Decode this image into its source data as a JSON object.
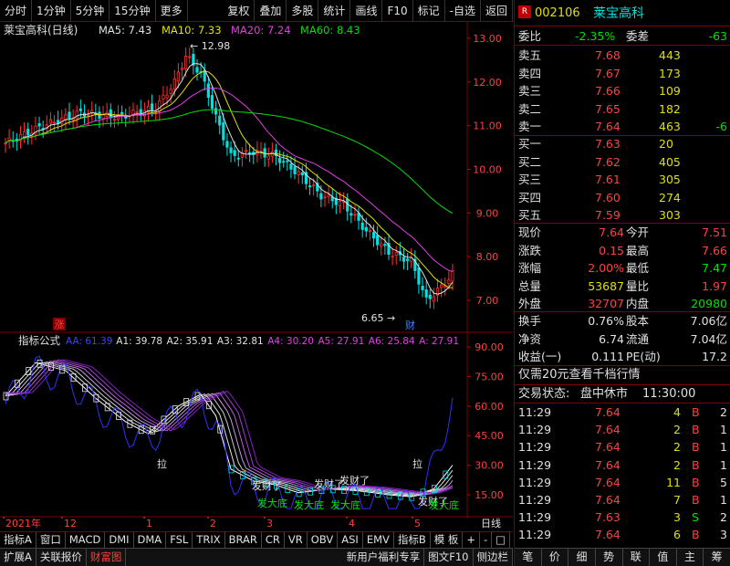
{
  "toolbar": {
    "left": [
      "分时",
      "1分钟",
      "5分钟",
      "15分钟",
      "更多"
    ],
    "right": [
      "复权",
      "叠加",
      "多股",
      "统计",
      "画线",
      "F10",
      "标记",
      "-自选",
      "返回"
    ]
  },
  "main_chart": {
    "title": "莱宝高科(日线)",
    "ma": [
      {
        "label": "MA5: 7.43",
        "color": "#e0e0e0"
      },
      {
        "label": "MA10: 7.33",
        "color": "#e0e000"
      },
      {
        "label": "MA20: 7.24",
        "color": "#e040e0"
      },
      {
        "label": "MA60: 8.43",
        "color": "#00e000"
      }
    ],
    "price_axis": [
      "13.00",
      "12.00",
      "11.00",
      "10.00",
      "9.00",
      "8.00",
      "7.00"
    ],
    "high_marker": "12.98",
    "low_marker": "6.65",
    "limit_up_badge": "涨",
    "cai_badge": "财"
  },
  "indicator_chart": {
    "title": "指标公式",
    "params": [
      {
        "label": "AA: 61.39",
        "color": "#4040ff"
      },
      {
        "label": "A1: 39.78",
        "color": "#e0e0e0"
      },
      {
        "label": "A2: 35.91",
        "color": "#e0e0e0"
      },
      {
        "label": "A3: 32.81",
        "color": "#e0e0e0"
      },
      {
        "label": "A4: 30.20",
        "color": "#e040e0"
      },
      {
        "label": "A5: 27.91",
        "color": "#e040e0"
      },
      {
        "label": "A6: 25.84",
        "color": "#e040e0"
      },
      {
        "label": "A: 27.91",
        "color": "#e040e0"
      }
    ],
    "axis": [
      "90.00",
      "75.00",
      "60.00",
      "45.00",
      "30.00",
      "15.00"
    ],
    "annotations": [
      "拉",
      "拉",
      "发财了",
      "发财了",
      "发财了",
      "发财了",
      "发大底",
      "发大底",
      "发大底",
      "发大底"
    ]
  },
  "date_axis": [
    "2021年",
    "12",
    "1",
    "2",
    "3",
    "4",
    "5",
    "日线"
  ],
  "ind_tabs": [
    "指标A",
    "窗口",
    "MACD",
    "DMI",
    "DMA",
    "FSL",
    "TRIX",
    "BRAR",
    "CR",
    "VR",
    "OBV",
    "ASI",
    "EMV",
    "指标B",
    "模 板",
    "+",
    "-",
    "□"
  ],
  "bottom_tabs": [
    "扩展A",
    "关联报价",
    "财富图",
    "新用户福利专享",
    "图文F10",
    "侧边栏"
  ],
  "quote": {
    "code": "002106",
    "name": "莱宝高科",
    "weibi_label": "委比",
    "weibi": "-2.35%",
    "weicha_label": "委差",
    "weicha": "-63",
    "asks": [
      {
        "label": "卖五",
        "price": "7.68",
        "vol": "443",
        "diff": ""
      },
      {
        "label": "卖四",
        "price": "7.67",
        "vol": "173",
        "diff": ""
      },
      {
        "label": "卖三",
        "price": "7.66",
        "vol": "109",
        "diff": ""
      },
      {
        "label": "卖二",
        "price": "7.65",
        "vol": "182",
        "diff": ""
      },
      {
        "label": "卖一",
        "price": "7.64",
        "vol": "463",
        "diff": "-6"
      }
    ],
    "bids": [
      {
        "label": "买一",
        "price": "7.63",
        "vol": "20"
      },
      {
        "label": "买二",
        "price": "7.62",
        "vol": "405"
      },
      {
        "label": "买三",
        "price": "7.61",
        "vol": "305"
      },
      {
        "label": "买四",
        "price": "7.60",
        "vol": "274"
      },
      {
        "label": "买五",
        "price": "7.59",
        "vol": "303"
      }
    ],
    "stats": [
      {
        "l1": "现价",
        "v1": "7.64",
        "c1": "red",
        "l2": "今开",
        "v2": "7.51",
        "c2": "red"
      },
      {
        "l1": "涨跌",
        "v1": "0.15",
        "c1": "red",
        "l2": "最高",
        "v2": "7.66",
        "c2": "red"
      },
      {
        "l1": "涨幅",
        "v1": "2.00%",
        "c1": "red",
        "l2": "最低",
        "v2": "7.47",
        "c2": "green"
      },
      {
        "l1": "总量",
        "v1": "53687",
        "c1": "yellow",
        "l2": "量比",
        "v2": "1.97",
        "c2": "red"
      },
      {
        "l1": "外盘",
        "v1": "32707",
        "c1": "red",
        "l2": "内盘",
        "v2": "20980",
        "c2": "green"
      }
    ],
    "stats2": [
      {
        "l1": "换手",
        "v1": "0.76%",
        "l2": "股本",
        "v2": "7.06亿"
      },
      {
        "l1": "净资",
        "v1": "6.74",
        "l2": "流通",
        "v2": "7.04亿"
      },
      {
        "l1": "收益(一)",
        "v1": "0.111",
        "l2": "PE(动)",
        "v2": "17.2"
      }
    ],
    "promo": "仅需20元查看千档行情",
    "status_label": "交易状态:",
    "status": "盘中休市",
    "status_time": "11:30:00",
    "ticks": [
      {
        "t": "11:29",
        "p": "7.64",
        "v": "4",
        "d": "B",
        "n": "2"
      },
      {
        "t": "11:29",
        "p": "7.64",
        "v": "2",
        "d": "B",
        "n": "1"
      },
      {
        "t": "11:29",
        "p": "7.64",
        "v": "2",
        "d": "B",
        "n": "1"
      },
      {
        "t": "11:29",
        "p": "7.64",
        "v": "2",
        "d": "B",
        "n": "1"
      },
      {
        "t": "11:29",
        "p": "7.64",
        "v": "11",
        "d": "B",
        "n": "5"
      },
      {
        "t": "11:29",
        "p": "7.64",
        "v": "7",
        "d": "B",
        "n": "1"
      },
      {
        "t": "11:29",
        "p": "7.63",
        "v": "3",
        "d": "S",
        "n": "2"
      },
      {
        "t": "11:29",
        "p": "7.64",
        "v": "6",
        "d": "B",
        "n": "3"
      }
    ],
    "rtabs": [
      "笔",
      "价",
      "细",
      "势",
      "联",
      "值",
      "主",
      "筹"
    ]
  }
}
